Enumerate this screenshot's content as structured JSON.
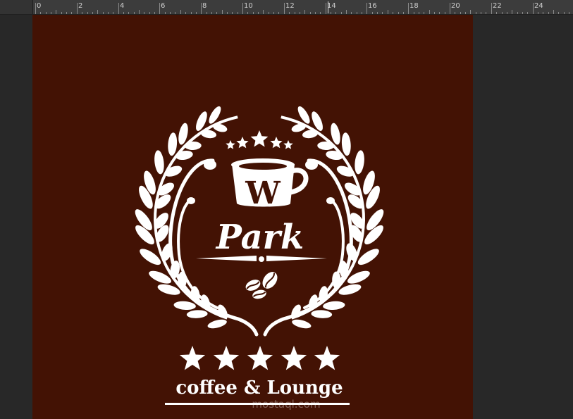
{
  "ruler": {
    "labels": [
      "0",
      "2",
      "4",
      "6",
      "8",
      "10",
      "12",
      "14",
      "16",
      "18",
      "20",
      "22",
      "24"
    ]
  },
  "logo": {
    "brand_letter": "W",
    "brand_name": "Park",
    "tagline": "coffee & Lounge",
    "top_stars": 5,
    "bottom_stars": 5,
    "background_color": "#431204",
    "foreground_color": "#ffffff"
  },
  "watermark": {
    "text": "mostaql.com"
  }
}
